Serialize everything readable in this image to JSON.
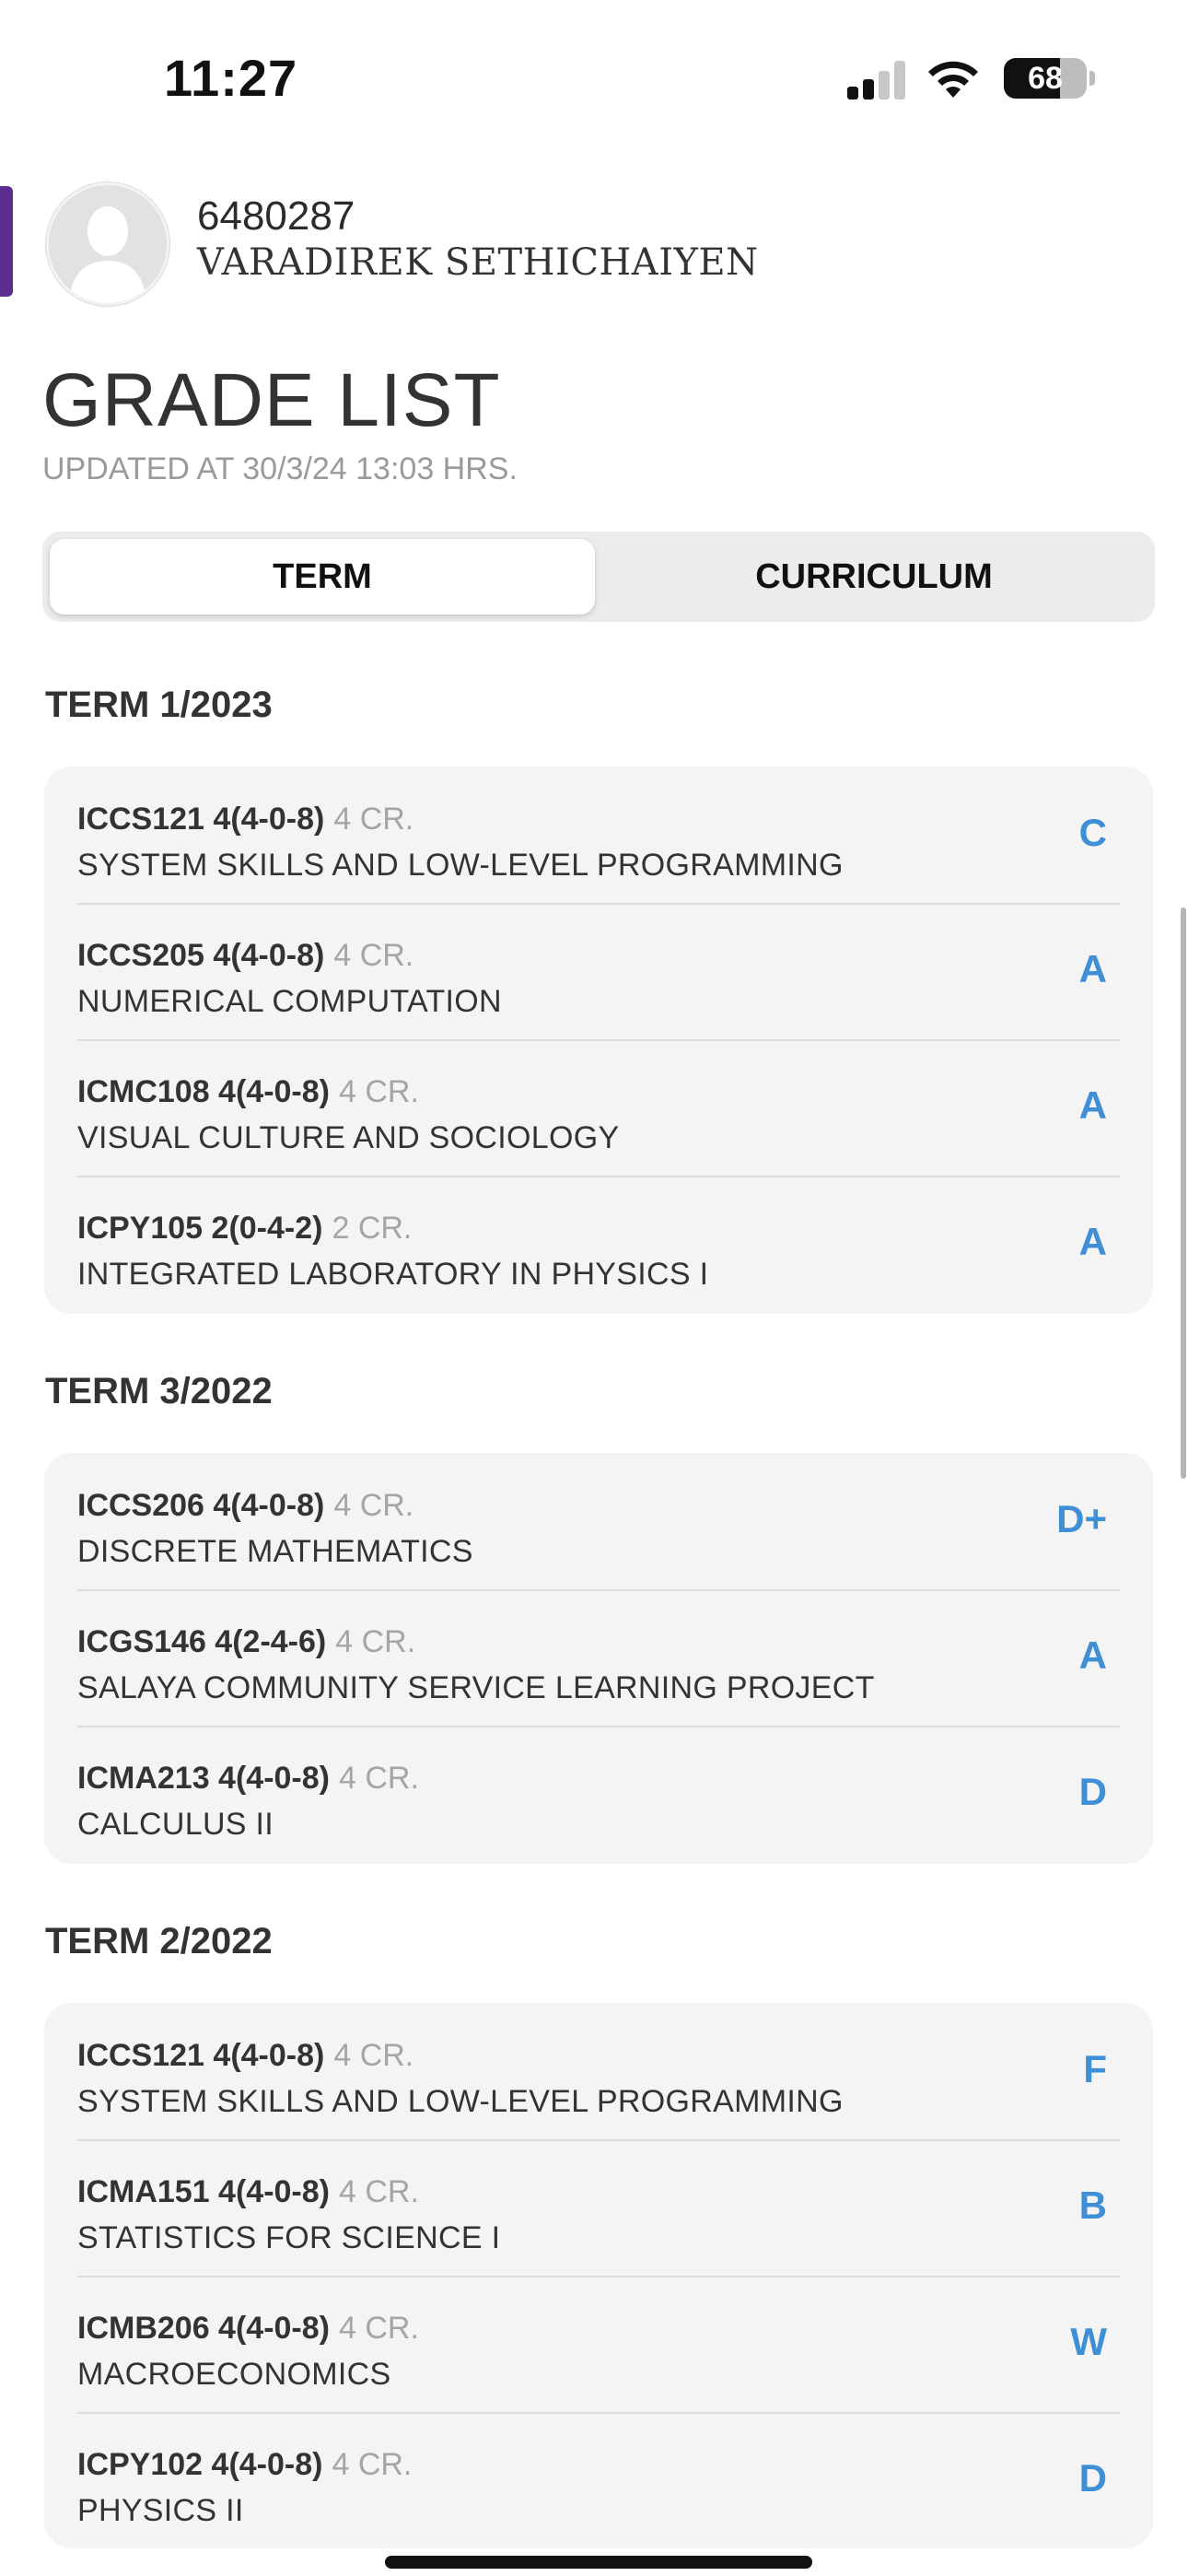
{
  "status_bar": {
    "time": "11:27",
    "battery": "68",
    "battery_level": 0.68
  },
  "profile": {
    "student_id": "6480287",
    "name": "VARADIREK SETHICHAIYEN"
  },
  "page": {
    "title": "GRADE LIST",
    "updated": "UPDATED AT 30/3/24 13:03 HRS."
  },
  "tabs": {
    "term": "TERM",
    "curriculum": "CURRICULUM",
    "selected": "TERM"
  },
  "terms": [
    {
      "title": "TERM 1/2023",
      "courses": [
        {
          "code": "ICCS121 4(4-0-8)",
          "credits": "4 CR.",
          "name": "SYSTEM SKILLS AND LOW-LEVEL PROGRAMMING",
          "grade": "C"
        },
        {
          "code": "ICCS205 4(4-0-8)",
          "credits": "4 CR.",
          "name": "NUMERICAL COMPUTATION",
          "grade": "A"
        },
        {
          "code": "ICMC108 4(4-0-8)",
          "credits": "4 CR.",
          "name": "VISUAL CULTURE AND SOCIOLOGY",
          "grade": "A"
        },
        {
          "code": "ICPY105 2(0-4-2)",
          "credits": "2 CR.",
          "name": "INTEGRATED LABORATORY IN PHYSICS I",
          "grade": "A"
        }
      ]
    },
    {
      "title": "TERM 3/2022",
      "courses": [
        {
          "code": "ICCS206 4(4-0-8)",
          "credits": "4 CR.",
          "name": "DISCRETE MATHEMATICS",
          "grade": "D+"
        },
        {
          "code": "ICGS146 4(2-4-6)",
          "credits": "4 CR.",
          "name": "SALAYA COMMUNITY SERVICE LEARNING PROJECT",
          "grade": "A"
        },
        {
          "code": "ICMA213 4(4-0-8)",
          "credits": "4 CR.",
          "name": "CALCULUS II",
          "grade": "D"
        }
      ]
    },
    {
      "title": "TERM 2/2022",
      "courses": [
        {
          "code": "ICCS121 4(4-0-8)",
          "credits": "4 CR.",
          "name": "SYSTEM SKILLS AND LOW-LEVEL PROGRAMMING",
          "grade": "F"
        },
        {
          "code": "ICMA151 4(4-0-8)",
          "credits": "4 CR.",
          "name": "STATISTICS FOR SCIENCE I",
          "grade": "B"
        },
        {
          "code": "ICMB206 4(4-0-8)",
          "credits": "4 CR.",
          "name": "MACROECONOMICS",
          "grade": "W"
        },
        {
          "code": "ICPY102 4(4-0-8)",
          "credits": "4 CR.",
          "name": "PHYSICS II",
          "grade": "D"
        }
      ]
    }
  ],
  "colors": {
    "grade": "#3e8fd6",
    "accent": "#5b2d8e",
    "card": "#f4f4f4"
  },
  "icons": {
    "signal": "cellular-signal-icon",
    "wifi": "wifi-icon",
    "battery": "battery-icon",
    "avatar": "user-silhouette-icon"
  }
}
